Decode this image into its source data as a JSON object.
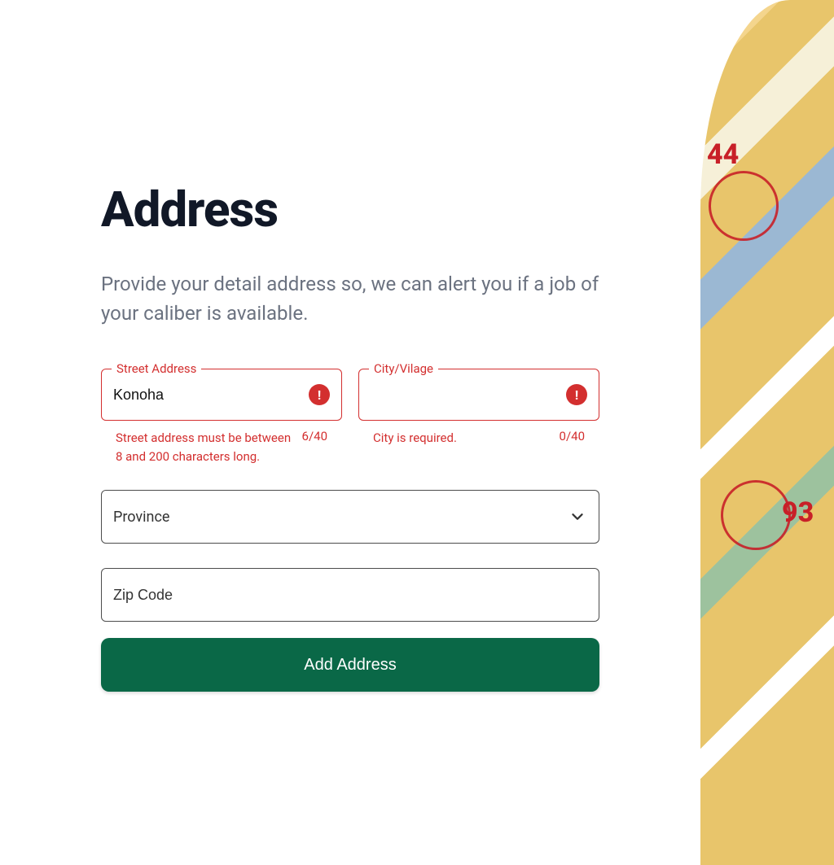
{
  "header": {
    "title": "Address",
    "description": "Provide your detail address so, we can alert you if a job of your caliber is available."
  },
  "fields": {
    "street": {
      "label": "Street Address",
      "value": "Konoha",
      "error": "Street address must be between 8 and 200 characters long.",
      "counter": "6/40"
    },
    "city": {
      "label": "City/Vilage",
      "value": "",
      "error": "City is required.",
      "counter": "0/40"
    },
    "province": {
      "placeholder": "Province"
    },
    "zip": {
      "placeholder": "Zip Code",
      "value": ""
    }
  },
  "submit_label": "Add Address",
  "map": {
    "num1": "44",
    "num2": "93"
  }
}
